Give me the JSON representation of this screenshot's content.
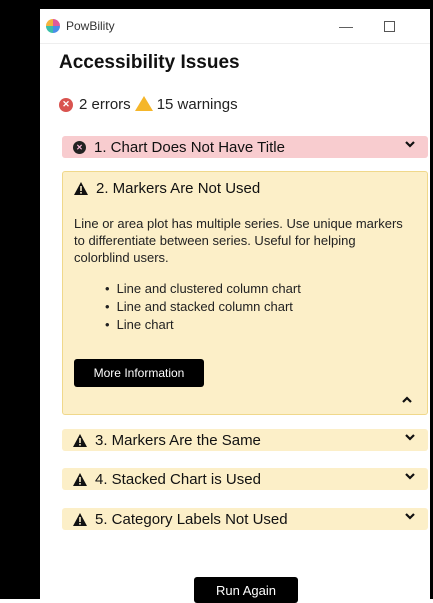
{
  "window": {
    "app_title": "PowBility",
    "minimize_symbol": "—"
  },
  "page_title": "Accessibility Issues",
  "summary": {
    "errors_text": "2 errors",
    "warnings_text": "15 warnings",
    "error_color": "#d9534f",
    "warning_color": "#f5b62a"
  },
  "issues": [
    {
      "title": "1. Chart Does Not Have Title",
      "severity": "error",
      "expanded": false
    },
    {
      "title": "2. Markers Are Not Used",
      "severity": "warning",
      "expanded": true,
      "description": "Line or area plot has multiple series. Use unique markers to differentiate between series. Useful for helping colorblind users.",
      "affected": [
        "Line and clustered column chart",
        "Line and stacked column chart",
        "Line chart"
      ],
      "more_label": "More Information"
    },
    {
      "title": "3. Markers Are the Same",
      "severity": "warning",
      "expanded": false
    },
    {
      "title": "4. Stacked Chart is Used",
      "severity": "warning",
      "expanded": false
    },
    {
      "title": "5. Category Labels Not Used",
      "severity": "warning",
      "expanded": false
    }
  ],
  "run_again_label": "Run Again"
}
